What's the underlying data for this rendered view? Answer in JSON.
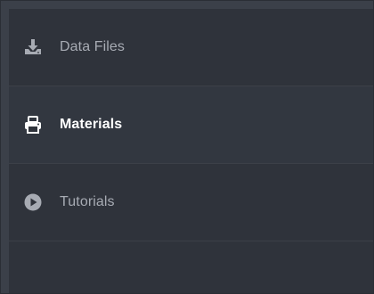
{
  "nav": {
    "items": [
      {
        "label": "Data Files",
        "icon": "download-icon",
        "active": false
      },
      {
        "label": "Materials",
        "icon": "printer-icon",
        "active": true
      },
      {
        "label": "Tutorials",
        "icon": "play-circle-icon",
        "active": false
      }
    ]
  },
  "colors": {
    "background": "#2f333b",
    "inactive_text": "#a7abb3",
    "active_text": "#ffffff"
  }
}
